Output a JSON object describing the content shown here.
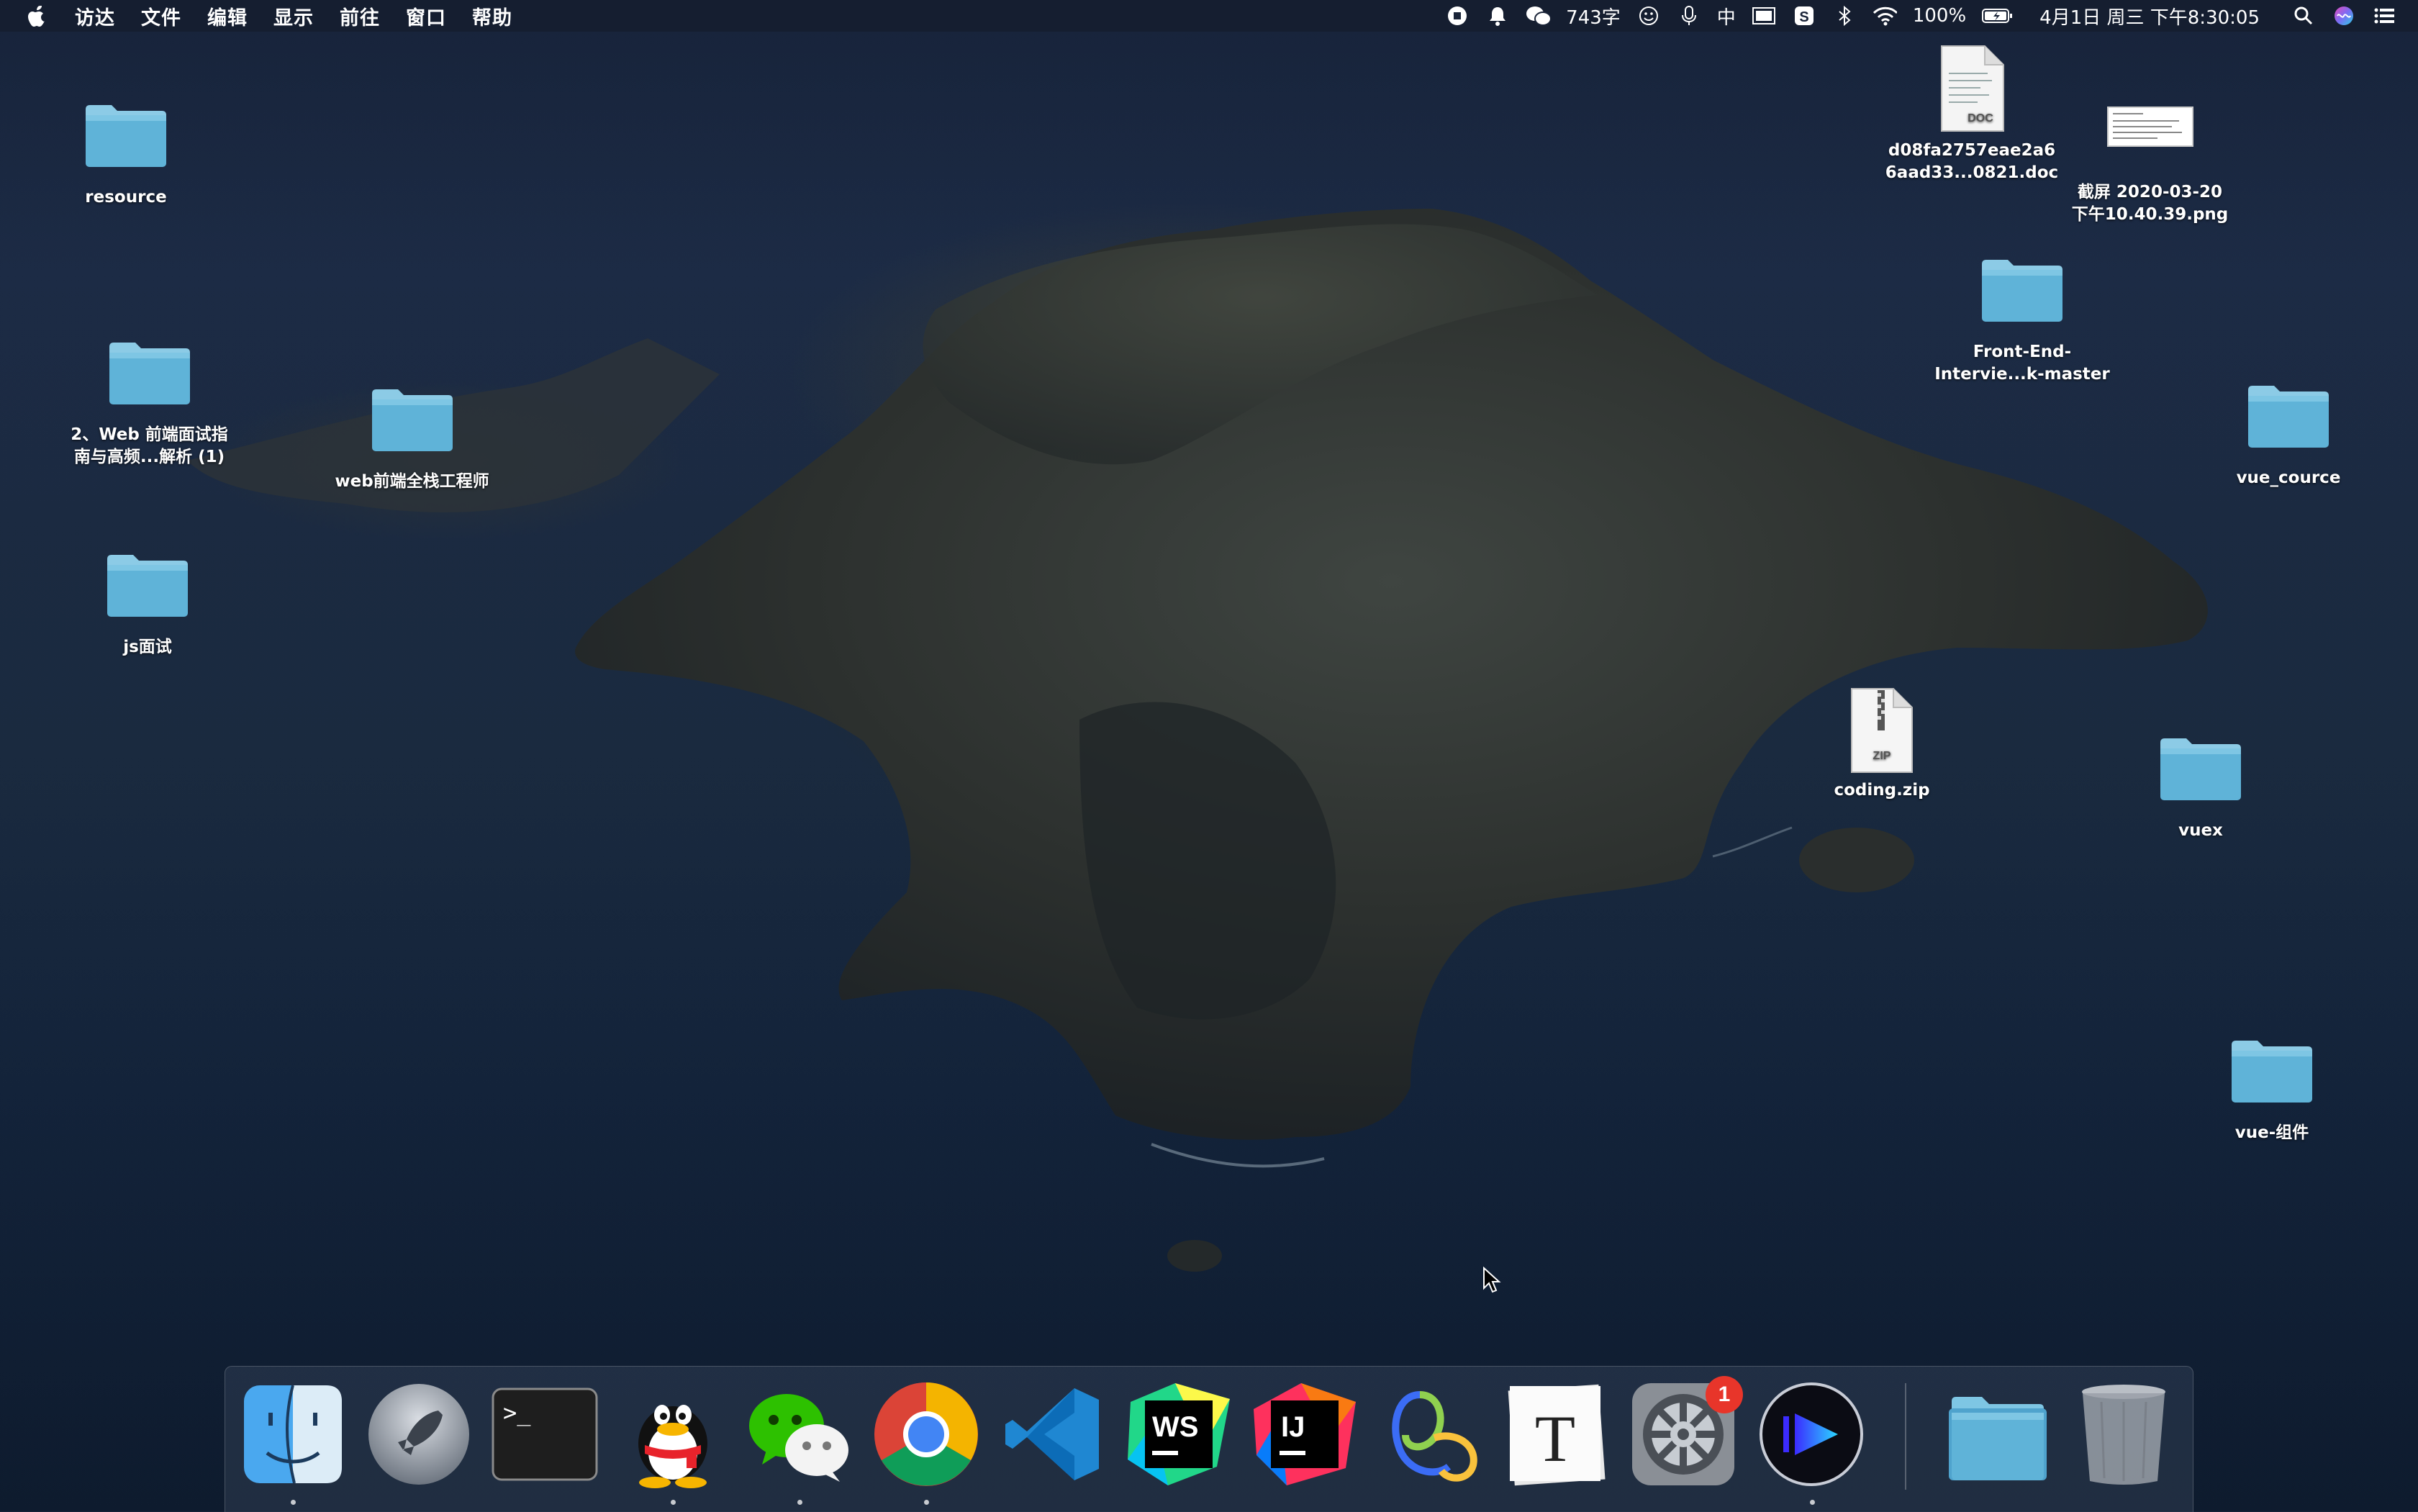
{
  "menubar": {
    "app_name": "访达",
    "menus": [
      "文件",
      "编辑",
      "显示",
      "前往",
      "窗口",
      "帮助"
    ],
    "word_count": "743字",
    "input_method": "中",
    "battery": "100%",
    "datetime": "4月1日 周三 下午8:30:05",
    "icons": [
      "stop-icon",
      "bell-icon",
      "wechat-icon",
      "smile-icon",
      "mic-icon",
      "ime-icon",
      "screen-icon",
      "sogou-icon",
      "bluetooth-icon",
      "wifi-icon",
      "battery-icon",
      "search-icon",
      "siri-icon",
      "control-center-icon"
    ]
  },
  "desktop": {
    "items": [
      {
        "name": "resource",
        "type": "folder"
      },
      {
        "name_line1": "2、Web 前端面试指",
        "name_line2": "南与高频...解析 (1)",
        "type": "folder"
      },
      {
        "name": "web前端全栈工程师",
        "type": "folder"
      },
      {
        "name": "js面试",
        "type": "folder"
      },
      {
        "name_line1": "d08fa2757eae2a6",
        "name_line2": "6aad33...0821.doc",
        "type": "doc",
        "badge": "DOC"
      },
      {
        "name_line1": "截屏 2020-03-20",
        "name_line2": "下午10.40.39.png",
        "type": "png"
      },
      {
        "name_line1": "Front-End-",
        "name_line2": "Intervie...k-master",
        "type": "folder"
      },
      {
        "name": "vue_cource",
        "type": "folder"
      },
      {
        "name": "coding.zip",
        "type": "zip",
        "badge": "ZIP"
      },
      {
        "name": "vuex",
        "type": "folder"
      },
      {
        "name": "vue-组件",
        "type": "folder"
      }
    ]
  },
  "dock": {
    "apps": [
      {
        "name": "finder-icon",
        "running": true
      },
      {
        "name": "launchpad-icon",
        "running": false
      },
      {
        "name": "terminal-icon",
        "running": false,
        "glyph": ">_"
      },
      {
        "name": "qq-icon",
        "running": true
      },
      {
        "name": "wechat-icon",
        "running": true
      },
      {
        "name": "chrome-icon",
        "running": true
      },
      {
        "name": "vscode-icon",
        "running": false
      },
      {
        "name": "webstorm-icon",
        "running": false,
        "glyph": "WS"
      },
      {
        "name": "intellij-icon",
        "running": false,
        "glyph": "IJ"
      },
      {
        "name": "creative-cloud-icon",
        "running": false
      },
      {
        "name": "typora-icon",
        "running": false,
        "glyph": "T"
      },
      {
        "name": "system-preferences-icon",
        "running": false,
        "badge": "1"
      },
      {
        "name": "infuse-player-icon",
        "running": true
      }
    ],
    "right": [
      "downloads-stack-icon",
      "trash-icon"
    ]
  },
  "colors": {
    "folder_top": "#7ec6e4",
    "folder_body": "#5fb3d8",
    "badge_red": "#e8352a"
  }
}
